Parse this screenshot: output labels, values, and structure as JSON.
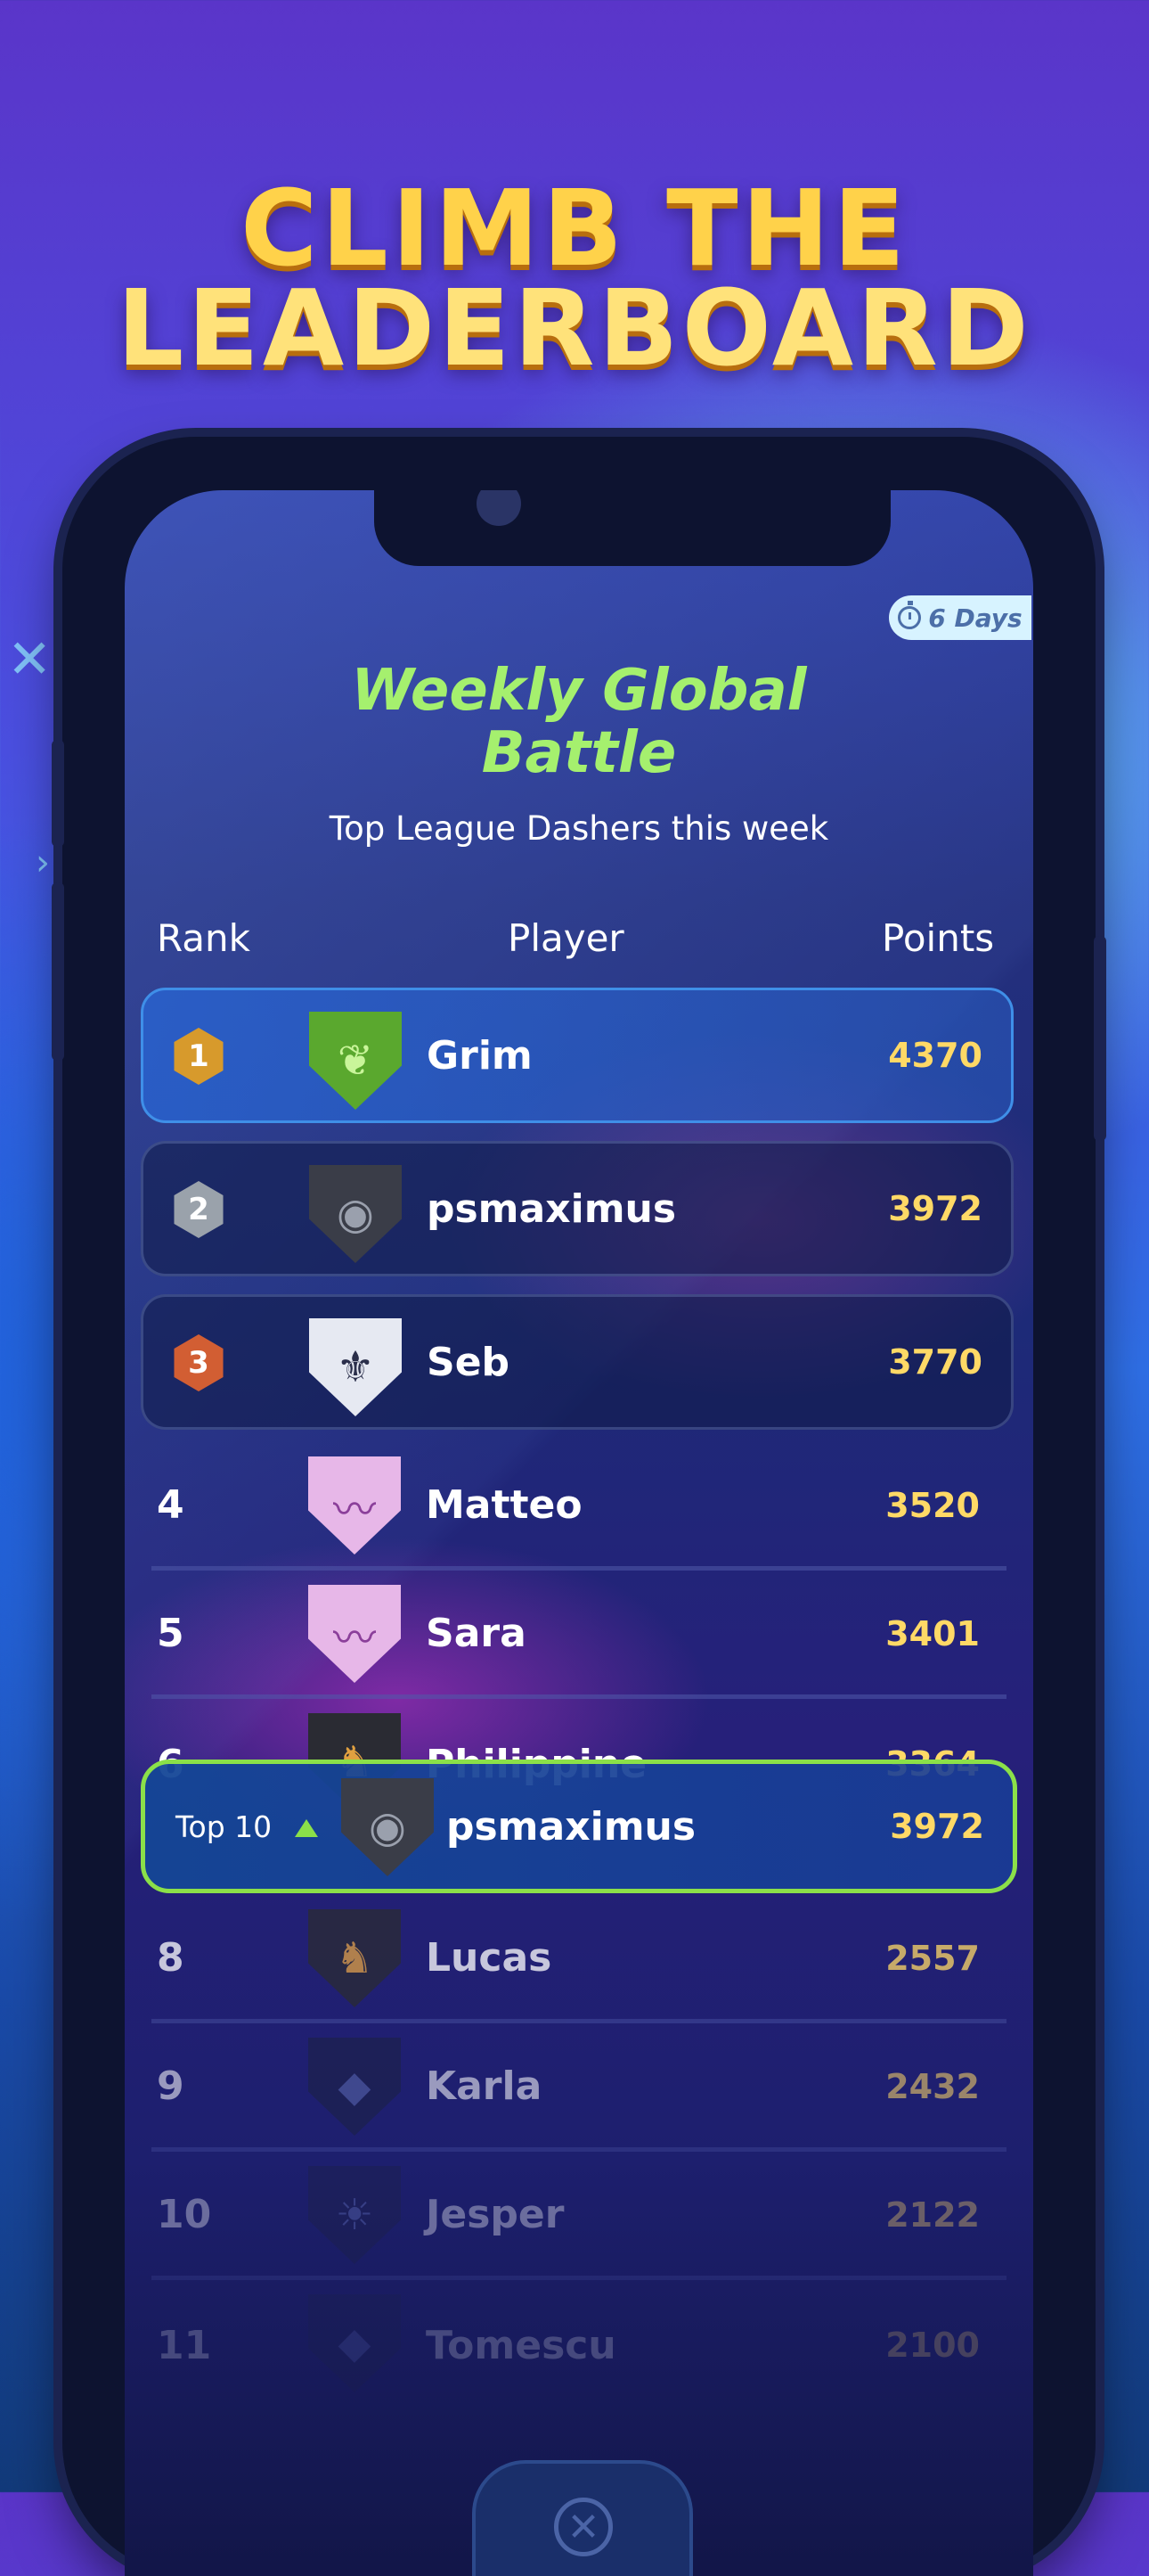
{
  "headline": {
    "line1": "CLIMB THE",
    "line2": "LEADERBOARD"
  },
  "timer": {
    "days_label": "6 Days",
    "icon": "stopwatch-icon"
  },
  "board": {
    "title_line1": "Weekly Global",
    "title_line2": "Battle",
    "subtitle": "Top League Dashers this week",
    "columns": {
      "rank": "Rank",
      "player": "Player",
      "points": "Points"
    }
  },
  "rows": [
    {
      "rank": "1",
      "name": "Grim",
      "points": "4370",
      "avatar": "leaf-shield-icon"
    },
    {
      "rank": "2",
      "name": "psmaximus",
      "points": "3972",
      "avatar": "gorilla-shield-icon"
    },
    {
      "rank": "3",
      "name": "Seb",
      "points": "3770",
      "avatar": "fleur-de-lis-icon"
    },
    {
      "rank": "4",
      "name": "Matteo",
      "points": "3520",
      "avatar": "mustache-shield-icon"
    },
    {
      "rank": "5",
      "name": "Sara",
      "points": "3401",
      "avatar": "mustache-shield-icon"
    },
    {
      "rank": "6",
      "name": "Philippine",
      "points": "3364",
      "avatar": "dog-shield-icon"
    },
    {
      "rank": "8",
      "name": "Lucas",
      "points": "2557",
      "avatar": "dog-shield-icon"
    },
    {
      "rank": "9",
      "name": "Karla",
      "points": "2432",
      "avatar": "panther-shield-icon"
    },
    {
      "rank": "10",
      "name": "Jesper",
      "points": "2122",
      "avatar": "owl-shield-icon"
    },
    {
      "rank": "11",
      "name": "Tomescu",
      "points": "2100",
      "avatar": "panther-shield-icon"
    }
  ],
  "current_user": {
    "rank_label": "Top 10",
    "name": "psmaximus",
    "points": "3972",
    "avatar": "gorilla-shield-icon"
  },
  "colors": {
    "accent_green": "#8be049",
    "title_green": "#a5f06e",
    "points_gold": "#ffd966",
    "headline_gold": "#ffd24a"
  }
}
